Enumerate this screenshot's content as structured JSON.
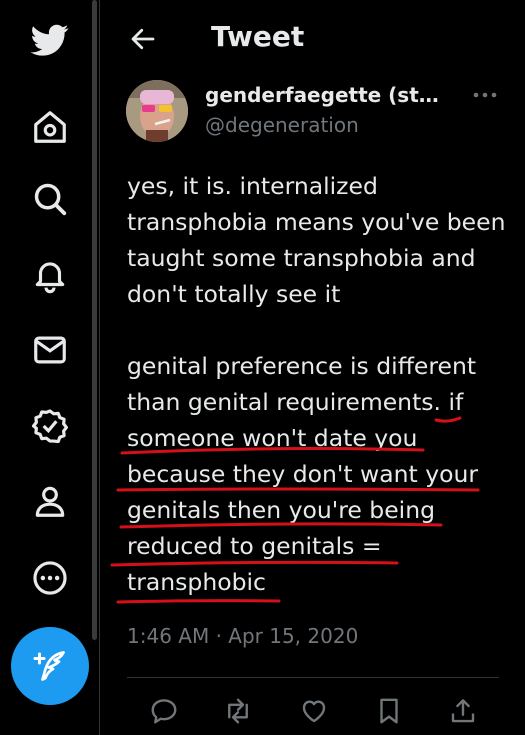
{
  "sidebar": {
    "items": [
      {
        "icon": "twitter-bird-icon"
      },
      {
        "icon": "home-icon"
      },
      {
        "icon": "search-icon"
      },
      {
        "icon": "notifications-bell-icon"
      },
      {
        "icon": "messages-envelope-icon"
      },
      {
        "icon": "verified-badge-icon"
      },
      {
        "icon": "profile-person-icon"
      },
      {
        "icon": "more-circle-icon"
      }
    ],
    "compose_icon": "compose-feather-icon"
  },
  "header": {
    "title": "Tweet"
  },
  "tweet": {
    "display_name": "genderfaegette (stil...",
    "handle": "@degeneration",
    "paragraph1": [
      "yes, it is. internalized",
      "transphobia means you've been",
      "taught some transphobia and",
      "don't totally see it"
    ],
    "paragraph2": [
      "genital preference is different",
      "than genital requirements. if",
      "someone won't date you",
      "because they don't want your",
      "genitals then you're being",
      "reduced to genitals =",
      "transphobic"
    ],
    "timestamp": "1:46 AM · Apr 15, 2020"
  },
  "actions": [
    {
      "icon": "reply-icon"
    },
    {
      "icon": "retweet-icon"
    },
    {
      "icon": "like-heart-icon"
    },
    {
      "icon": "bookmark-icon"
    },
    {
      "icon": "share-icon"
    }
  ],
  "colors": {
    "accent": "#1d9bf0",
    "annotation": "#d6101a",
    "background": "#000000",
    "secondary_text": "#71767b"
  }
}
